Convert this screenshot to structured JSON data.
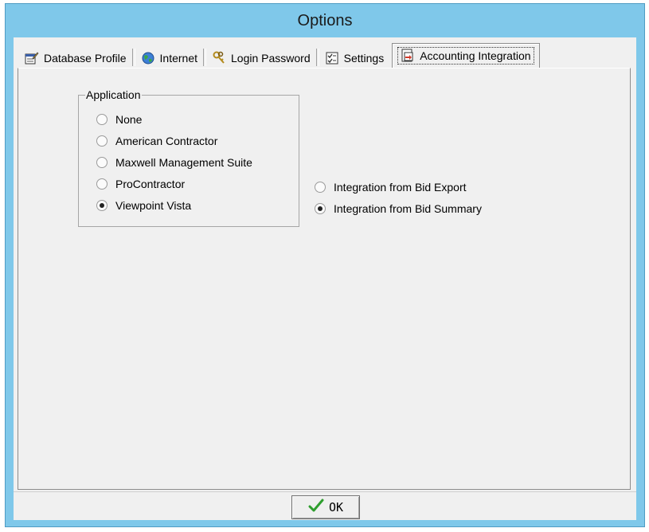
{
  "window": {
    "title": "Options"
  },
  "tabs": [
    {
      "label": "Database Profile",
      "icon": "notepad-pencil-icon"
    },
    {
      "label": "Internet",
      "icon": "globe-icon"
    },
    {
      "label": "Login Password",
      "icon": "keys-icon"
    },
    {
      "label": "Settings",
      "icon": "checklist-icon"
    },
    {
      "label": "Accounting Integration",
      "icon": "export-document-icon",
      "active": true
    }
  ],
  "application_group": {
    "legend": "Application",
    "options": [
      {
        "label": "None",
        "checked": false
      },
      {
        "label": "American Contractor",
        "checked": false
      },
      {
        "label": "Maxwell Management Suite",
        "checked": false
      },
      {
        "label": "ProContractor",
        "checked": false
      },
      {
        "label": "Viewpoint Vista",
        "checked": true
      }
    ]
  },
  "integration_options": [
    {
      "label": "Integration from Bid Export",
      "checked": false
    },
    {
      "label": "Integration from Bid Summary",
      "checked": true
    }
  ],
  "footer": {
    "ok_label": "OK"
  },
  "colors": {
    "titlebar": "#7fc8ea",
    "client": "#f0f0f0",
    "check": "#2e9e2e"
  }
}
